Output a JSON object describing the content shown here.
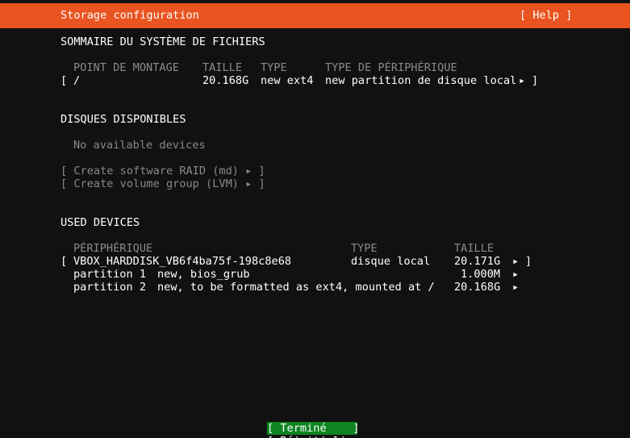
{
  "header": {
    "title": "Storage configuration",
    "help": "[ Help ]"
  },
  "fs_summary": {
    "section_title": "SOMMAIRE DU SYSTÈME DE FICHIERS",
    "columns": [
      "POINT DE MONTAGE",
      "TAILLE",
      "TYPE",
      "TYPE DE PÉRIPHÉRIQUE"
    ],
    "rows": [
      {
        "open": "[",
        "mount": "/",
        "size": "20.168G",
        "type": "new ext4",
        "device_type": "new partition de disque local",
        "arrow": "▸",
        "close": "]"
      }
    ]
  },
  "available": {
    "section_title": "DISQUES DISPONIBLES",
    "empty_text": "No available devices",
    "raid_button": "[ Create software RAID (md) ▸ ]",
    "lvm_button": "[ Create volume group (LVM) ▸ ]"
  },
  "used": {
    "section_title": "USED DEVICES",
    "columns": [
      "PÉRIPHÉRIQUE",
      "TYPE",
      "TAILLE"
    ],
    "disk": {
      "open": "[",
      "name": "VBOX_HARDDISK_VB6f4ba75f-198c8e68",
      "type": "disque local",
      "size": "20.171G",
      "arrow": "▸",
      "close": "]"
    },
    "partitions": [
      {
        "name": "partition 1",
        "desc": "new, bios_grub",
        "size": "1.000M",
        "arrow": "▸"
      },
      {
        "name": "partition 2",
        "desc": "new, to be formatted as ext4, mounted at /",
        "size": "20.168G",
        "arrow": "▸"
      }
    ]
  },
  "footer": {
    "done": "[ Terminé    ]",
    "second": "[ Réinitialiser ]"
  }
}
